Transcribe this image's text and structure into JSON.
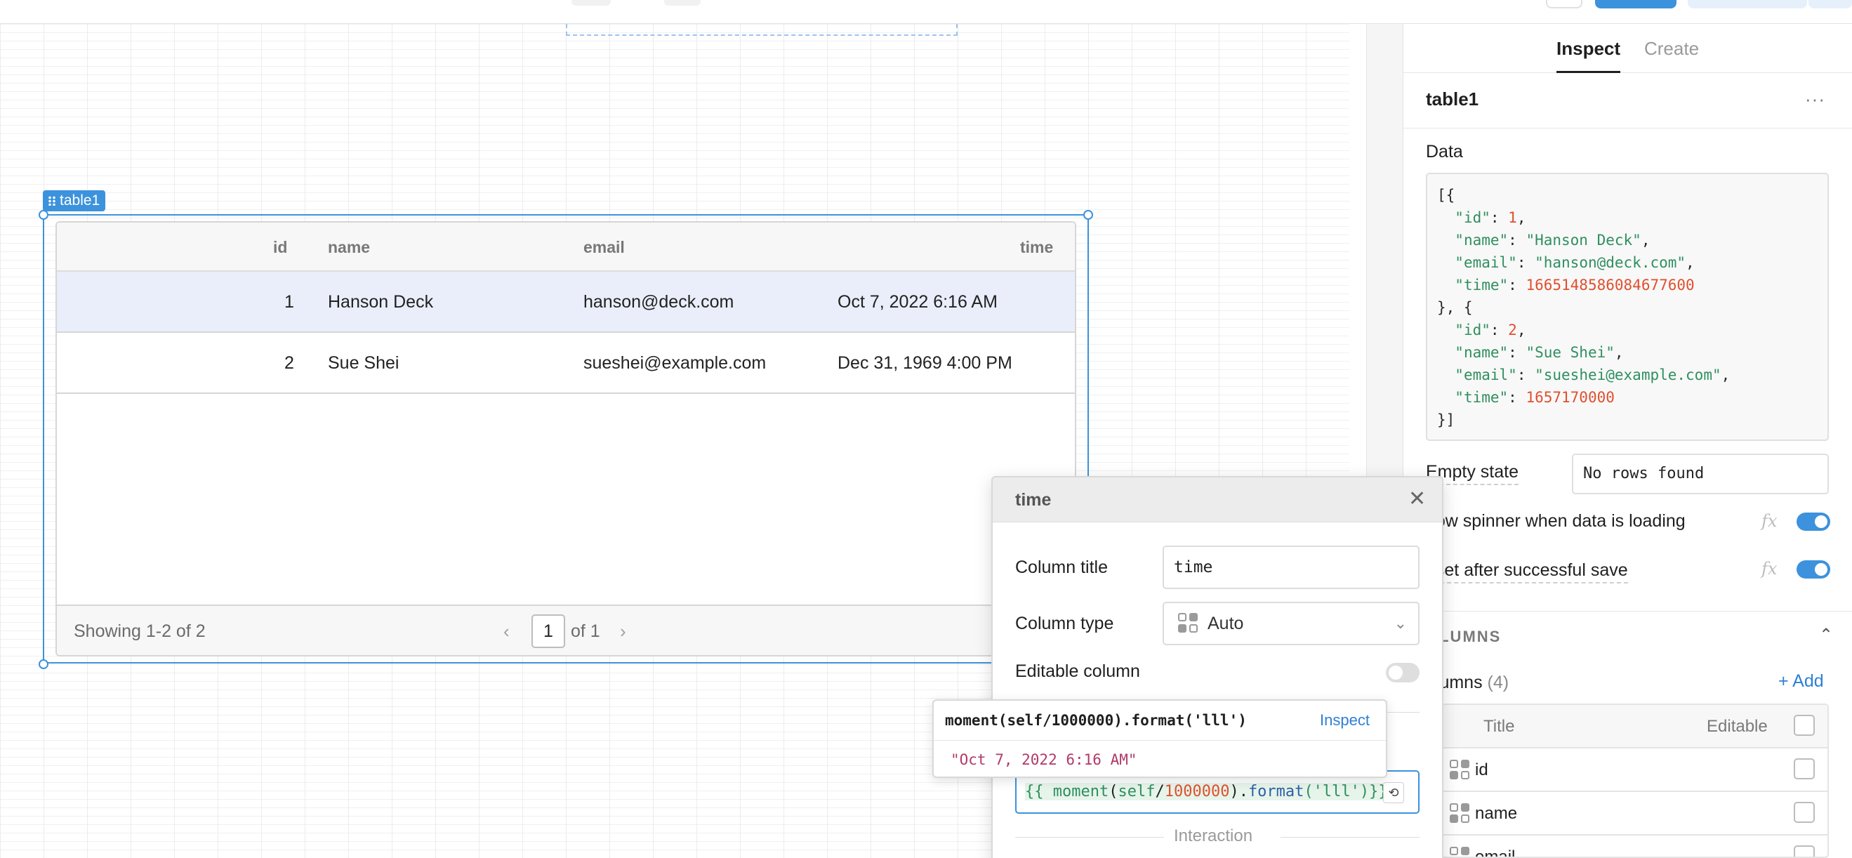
{
  "panel": {
    "tabs": [
      {
        "label": "Inspect"
      },
      {
        "label": "Create"
      }
    ],
    "component_name": "table1",
    "more_label": "···",
    "data_label": "Data",
    "data_json": {
      "l1": "[{",
      "r1_k": "\"id\"",
      "r1_v": "1",
      "r1n_k": "\"name\"",
      "r1n_v": "\"Hanson Deck\"",
      "r1e_k": "\"email\"",
      "r1e_v": "\"hanson@deck.com\"",
      "r1t_k": "\"time\"",
      "r1t_v": "1665148586084677600",
      "mid": "}, {",
      "r2_k": "\"id\"",
      "r2_v": "2",
      "r2n_k": "\"name\"",
      "r2n_v": "\"Sue Shei\"",
      "r2e_k": "\"email\"",
      "r2e_v": "\"sueshei@example.com\"",
      "r2t_k": "\"time\"",
      "r2t_v": "1657170000",
      "end": "}]"
    },
    "empty_state_label": "Empty state",
    "empty_state_value": "No rows found",
    "spinner_label": "how spinner when data is loading",
    "reset_label": "eset after successful save",
    "fx_label": "fx",
    "columns_section": "OLUMNS",
    "columns_label": "olumns",
    "columns_count": "(4)",
    "add_label": "+ Add",
    "columns_table": {
      "title_header": "Title",
      "editable_header": "Editable",
      "rows": [
        {
          "name": "id"
        },
        {
          "name": "name"
        },
        {
          "name": "email"
        }
      ]
    }
  },
  "table": {
    "tag": "table1",
    "headers": {
      "id": "id",
      "name": "name",
      "email": "email",
      "time": "time"
    },
    "rows": [
      {
        "id": "1",
        "name": "Hanson Deck",
        "email": "hanson@deck.com",
        "time": "Oct 7, 2022 6:16 AM"
      },
      {
        "id": "2",
        "name": "Sue Shei",
        "email": "sueshei@example.com",
        "time": "Dec 31, 1969 4:00 PM"
      }
    ],
    "footer": {
      "showing": "Showing 1-2 of 2",
      "page": "1",
      "of": "of 1",
      "prev": "‹",
      "next": "›"
    }
  },
  "popover": {
    "title": "time",
    "close": "✕",
    "column_title_label": "Column title",
    "column_title_value": "time",
    "column_type_label": "Column type",
    "column_type_value": "Auto",
    "editable_label": "Editable column",
    "mapper": {
      "open": "{{ ",
      "fn": "moment",
      "lp": "(",
      "self": "self",
      "div": "/",
      "num": "1000000",
      "rp": ")",
      "dot": ".",
      "method": "format",
      "arg": "('lll')",
      "close": "}}"
    },
    "interaction_label": "Interaction"
  },
  "eval_tooltip": {
    "expression": "moment(self/1000000).format('lll')",
    "inspect_label": "Inspect",
    "result": "\"Oct 7, 2022 6:16 AM\""
  },
  "colors": {
    "accent": "#3c92dc",
    "number": "#e0502e",
    "string": "#2f8f5f"
  }
}
